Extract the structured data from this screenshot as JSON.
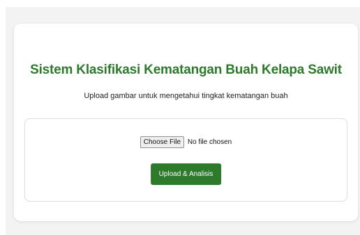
{
  "page": {
    "title": "Sistem Klasifikasi Kematangan Buah Kelapa Sawit",
    "subtitle": "Upload gambar untuk mengetahui tingkat kematangan buah"
  },
  "upload_form": {
    "choose_file_label": "Choose File",
    "file_status": "No file chosen",
    "submit_label": "Upload & Analisis"
  },
  "colors": {
    "accent": "#2d7a2d",
    "page_background": "#f2f3f2",
    "card_background": "#ffffff"
  }
}
